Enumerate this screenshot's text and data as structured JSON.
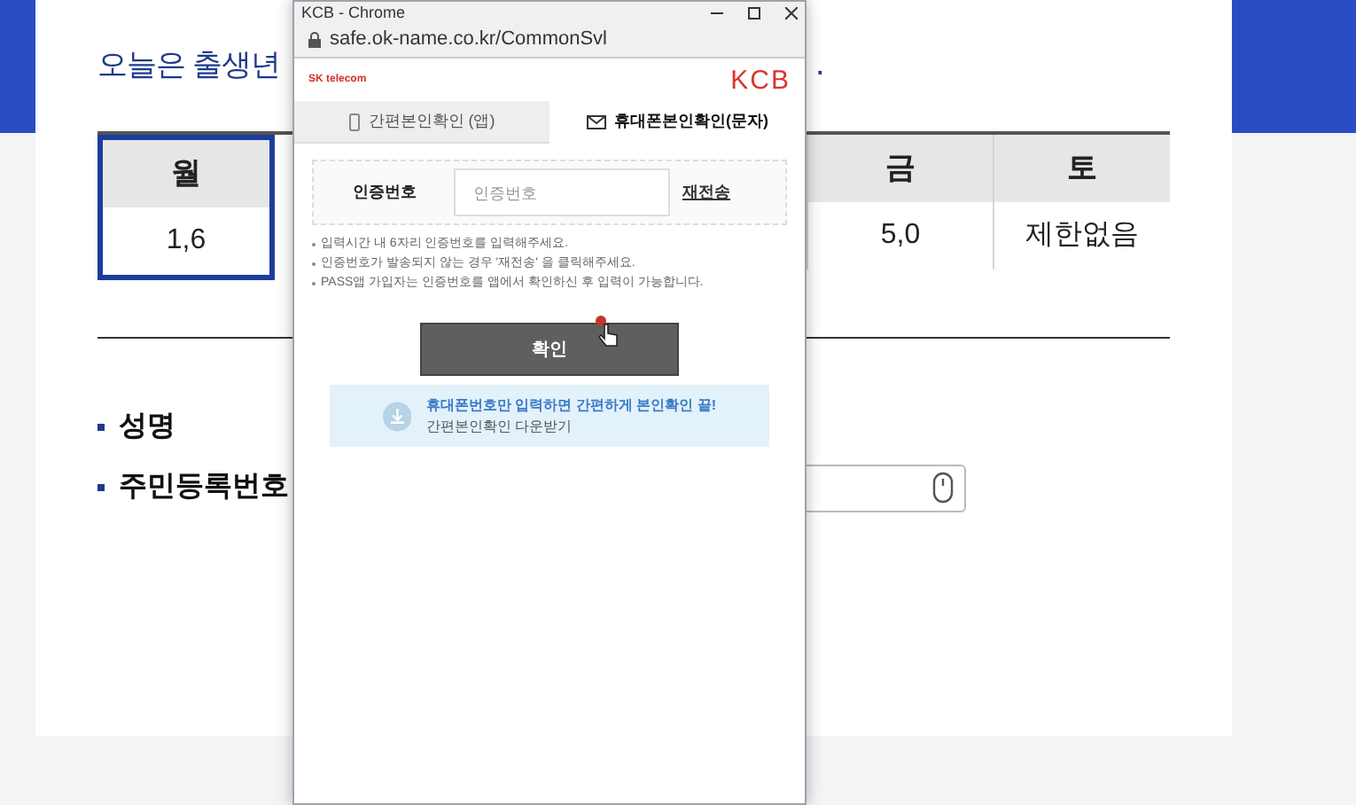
{
  "page": {
    "heading_start": "오늘은 출생년",
    "heading_end": ".",
    "table": {
      "columns": [
        {
          "header": "월",
          "value": "1,6",
          "selected": true
        },
        {
          "header": "금",
          "value": "5,0",
          "selected": false
        },
        {
          "header": "토",
          "value": "제한없음",
          "selected": false
        }
      ]
    },
    "fields": [
      {
        "label": "성명"
      },
      {
        "label": "주민등록번호"
      }
    ]
  },
  "popup": {
    "title": "KCB - Chrome",
    "url": "safe.ok-name.co.kr/CommonSvl",
    "logo_left": "SK telecom",
    "logo_right": "KCB",
    "tabs": [
      {
        "label": "간편본인확인 (앱)",
        "selected": false,
        "kind": "phone"
      },
      {
        "label": "휴대폰본인확인(문자)",
        "selected": true,
        "kind": "mail"
      }
    ],
    "form": {
      "label": "인증번호",
      "placeholder": "인증번호",
      "resend": "재전송"
    },
    "notes": [
      "입력시간 내 6자리 인증번호를 입력해주세요.",
      "인증번호가 발송되지 않는 경우 '재전송' 을 클릭해주세요.",
      "PASS앱 가입자는 인증번호를 앱에서 확인하신 후 입력이 가능합니다."
    ],
    "confirm": "확인",
    "banner": {
      "title": "휴대폰번호만 입력하면 간편하게 본인확인 끝!",
      "subtitle": "간편본인확인 다운받기"
    }
  }
}
